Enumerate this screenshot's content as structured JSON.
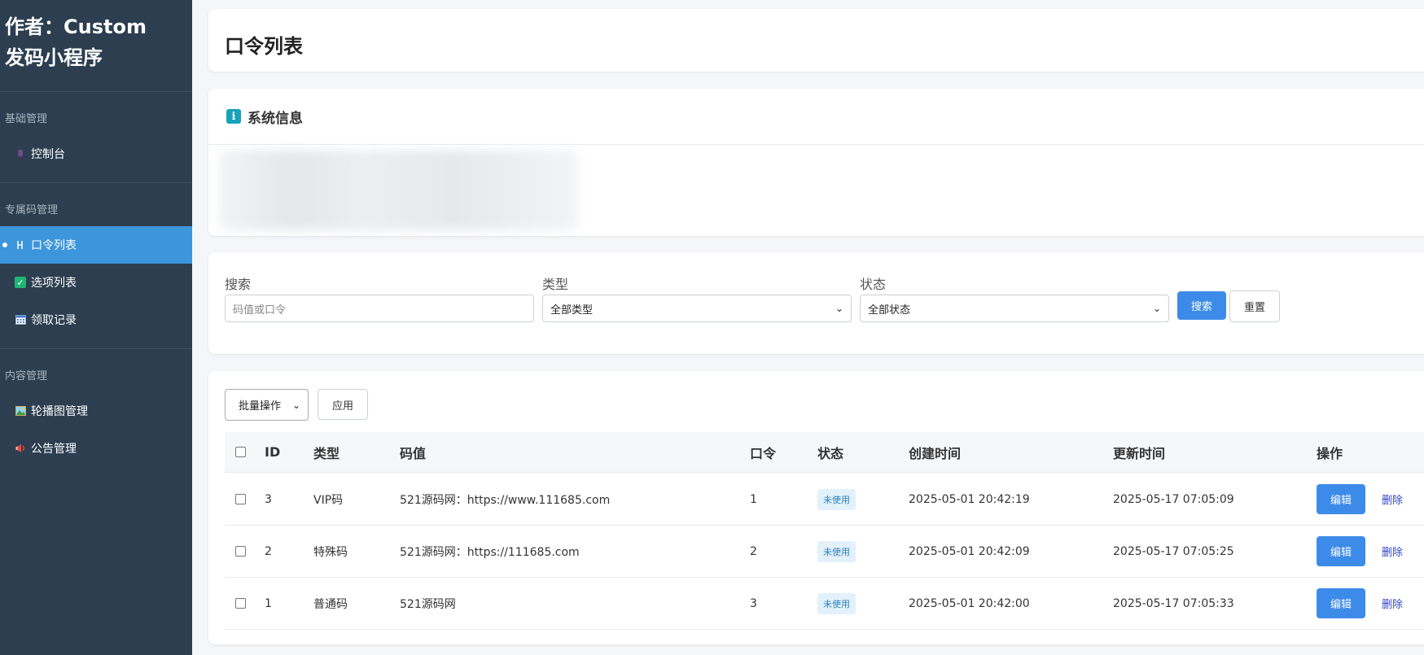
{
  "sidebar": {
    "brand_line1": "作者：Custom",
    "brand_line2": "发码小程序",
    "groups": [
      {
        "title": "基础管理",
        "items": [
          {
            "label": "控制台",
            "icon": "dashboard-icon"
          }
        ]
      },
      {
        "title": "专属码管理",
        "items": [
          {
            "label": "口令列表",
            "icon": "list-icon",
            "active": true
          },
          {
            "label": "选项列表",
            "icon": "checkbox-icon"
          },
          {
            "label": "领取记录",
            "icon": "calendar-icon"
          }
        ]
      },
      {
        "title": "内容管理",
        "items": [
          {
            "label": "轮播图管理",
            "icon": "image-icon"
          },
          {
            "label": "公告管理",
            "icon": "megaphone-icon"
          }
        ]
      }
    ]
  },
  "header": {
    "title": "口令列表"
  },
  "info": {
    "title": "系统信息",
    "icon_glyph": "i"
  },
  "filters": {
    "search_label": "搜索",
    "search_placeholder": "码值或口令",
    "type_label": "类型",
    "type_value": "全部类型",
    "status_label": "状态",
    "status_value": "全部状态",
    "search_button": "搜索",
    "reset_button": "重置"
  },
  "table": {
    "bulk_action": "批量操作",
    "apply_button": "应用",
    "columns": [
      "ID",
      "类型",
      "码值",
      "口令",
      "状态",
      "创建时间",
      "更新时间",
      "操作"
    ],
    "rows": [
      {
        "id": "3",
        "type": "VIP码",
        "code": "521源码网：https://www.111685.com",
        "token": "1",
        "status": "未使用",
        "created": "2025-05-01 20:42:19",
        "updated": "2025-05-17 07:05:09"
      },
      {
        "id": "2",
        "type": "特殊码",
        "code": "521源码网：https://111685.com",
        "token": "2",
        "status": "未使用",
        "created": "2025-05-01 20:42:09",
        "updated": "2025-05-17 07:05:25"
      },
      {
        "id": "1",
        "type": "普通码",
        "code": "521源码网",
        "token": "3",
        "status": "未使用",
        "created": "2025-05-01 20:42:00",
        "updated": "2025-05-17 07:05:33"
      }
    ],
    "edit_label": "编辑",
    "delete_label": "删除"
  },
  "colors": {
    "sidebar_bg": "#2c3e50",
    "active_bg": "#3d95dc",
    "primary": "#3d8be8",
    "badge_bg": "#e3f1fb"
  }
}
